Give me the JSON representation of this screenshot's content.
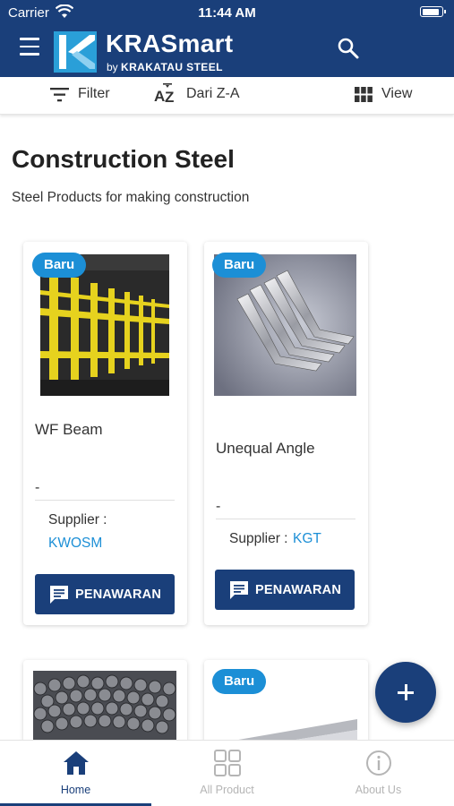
{
  "status_bar": {
    "carrier": "Carrier",
    "time": "11:44 AM",
    "battery_level": 0.9
  },
  "header": {
    "brand_name": "KRASmart",
    "brand_by": "by",
    "brand_company": "KRAKATAU STEEL"
  },
  "filter_bar": {
    "filter_label": "Filter",
    "sort_label": "Dari Z-A",
    "view_label": "View"
  },
  "category": {
    "title": "Construction Steel",
    "subtitle": "Steel Products for making construction"
  },
  "products": [
    {
      "badge": "Baru",
      "name": "WF Beam",
      "price": "-",
      "supplier_label": "Supplier :",
      "supplier": "KWOSM",
      "button_label": "PENAWARAN"
    },
    {
      "badge": "Baru",
      "name": "Unequal Angle",
      "price": "-",
      "supplier_label": "Supplier :",
      "supplier": "KGT",
      "button_label": "PENAWARAN"
    },
    {
      "badge": ""
    },
    {
      "badge": "Baru"
    }
  ],
  "bottom_nav": [
    {
      "label": "Home",
      "icon": "home-icon",
      "active": true
    },
    {
      "label": "All Product",
      "icon": "grid-icon",
      "active": false
    },
    {
      "label": "About Us",
      "icon": "info-icon",
      "active": false
    }
  ],
  "colors": {
    "primary": "#1a3f7a",
    "accent": "#1c8fd6",
    "inactive": "#b5b5b5"
  }
}
